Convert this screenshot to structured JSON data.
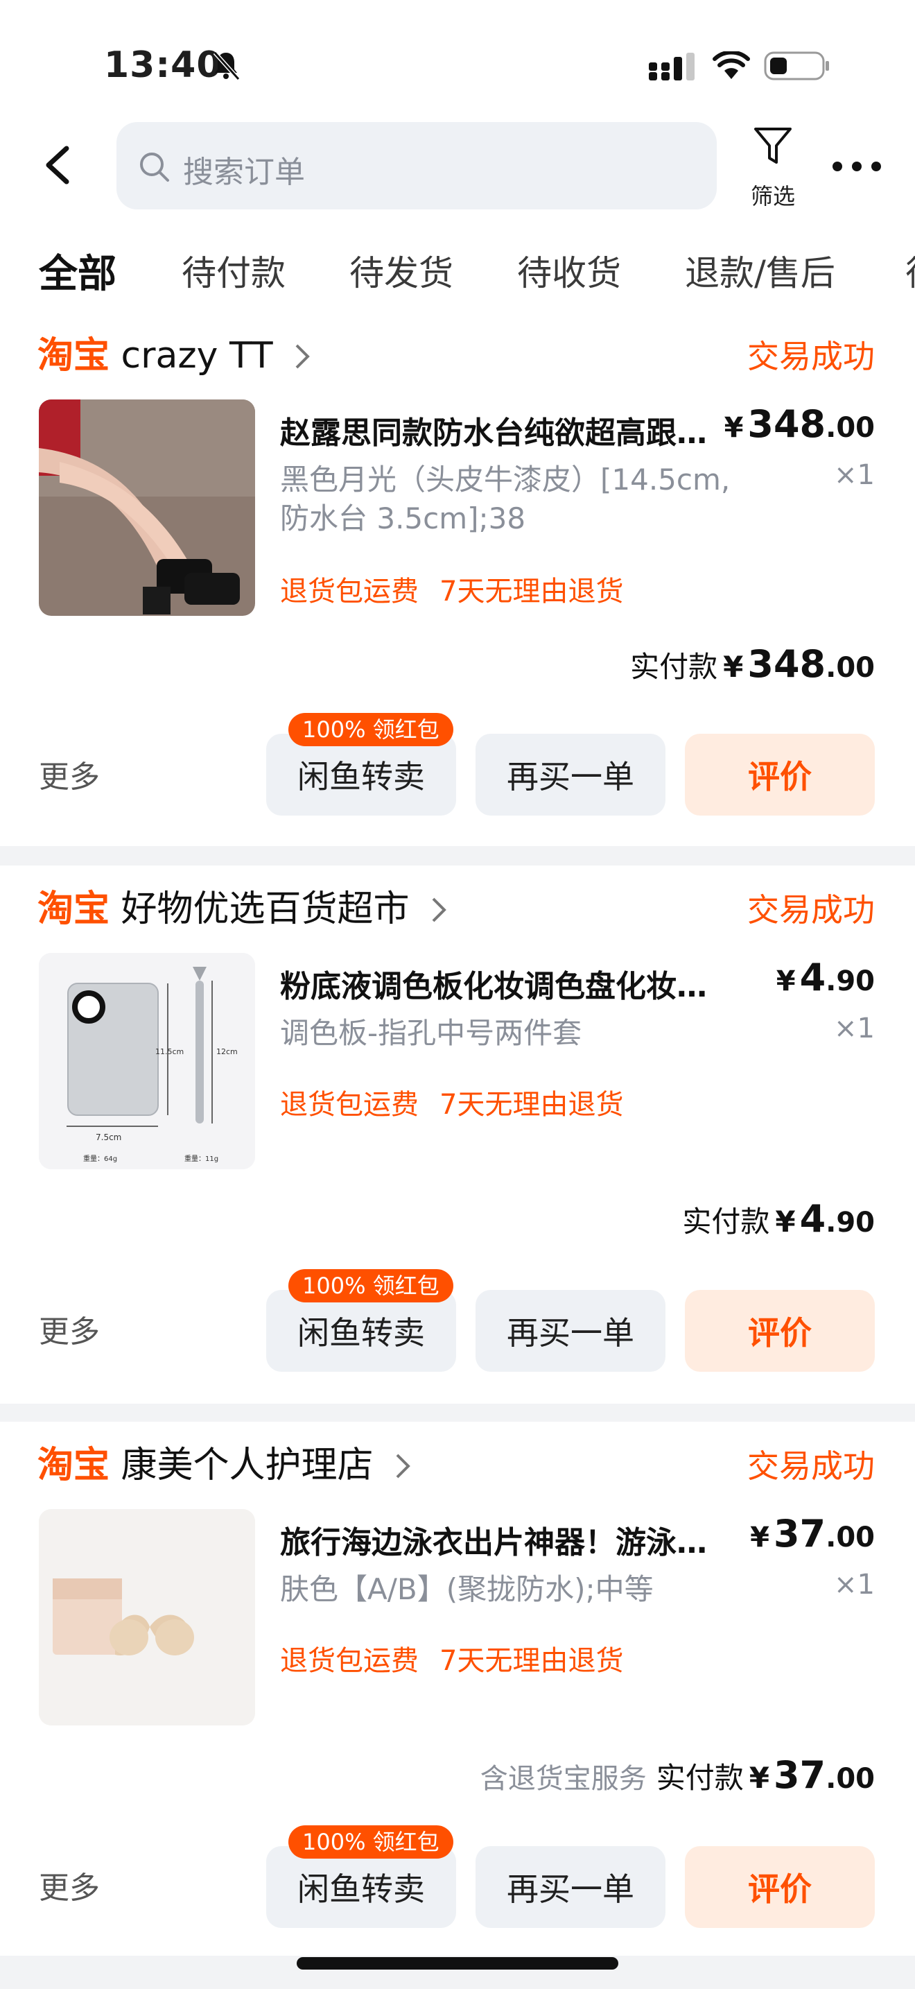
{
  "status_bar": {
    "time": "13:40"
  },
  "header": {
    "search_placeholder": "搜索订单",
    "filter_label": "筛选"
  },
  "tabs": [
    "全部",
    "待付款",
    "待发货",
    "待收货",
    "退款/售后",
    "待"
  ],
  "colors": {
    "accent": "#ff5000",
    "button_bg": "#eef1f5",
    "primary_button_bg": "#ffece0"
  },
  "orders": [
    {
      "platform": "淘宝",
      "shop": "crazy TT",
      "status": "交易成功",
      "title": "赵露思同款防水台纯欲超高跟…",
      "price_currency": "¥",
      "price_int": "348",
      "price_dec": ".00",
      "spec": "黑色月光（头皮牛漆皮）[14.5cm, 防水台 3.5cm];38",
      "qty": "×1",
      "tags": [
        "退货包运费",
        "7天无理由退货"
      ],
      "service_note": "",
      "paid_label": "实付款",
      "paid_currency": "¥",
      "paid_int": "348",
      "paid_dec": ".00",
      "more": "更多",
      "badge": "100% 领红包",
      "btn_resell": "闲鱼转卖",
      "btn_rebuy": "再买一单",
      "btn_review": "评价"
    },
    {
      "platform": "淘宝",
      "shop": "好物优选百货超市",
      "status": "交易成功",
      "title": "粉底液调色板化妆调色盘化妆师…",
      "price_currency": "¥",
      "price_int": "4",
      "price_dec": ".90",
      "spec": "调色板-指孔中号两件套",
      "qty": "×1",
      "tags": [
        "退货包运费",
        "7天无理由退货"
      ],
      "service_note": "",
      "paid_label": "实付款",
      "paid_currency": "¥",
      "paid_int": "4",
      "paid_dec": ".90",
      "more": "更多",
      "badge": "100% 领红包",
      "btn_resell": "闲鱼转卖",
      "btn_rebuy": "再买一单",
      "btn_review": "评价",
      "image_text": {
        "w": "7.5cm",
        "h1": "11.5cm",
        "h2": "12cm",
        "weight1": "重量：64g",
        "weight2": "重量：11g"
      }
    },
    {
      "platform": "淘宝",
      "shop": "康美个人护理店",
      "status": "交易成功",
      "title": "旅行海边泳衣出片神器！游泳胸…",
      "price_currency": "¥",
      "price_int": "37",
      "price_dec": ".00",
      "spec": "肤色【A/B】(聚拢防水);中等",
      "qty": "×1",
      "tags": [
        "退货包运费",
        "7天无理由退货"
      ],
      "service_note": "含退货宝服务",
      "paid_label": "实付款",
      "paid_currency": "¥",
      "paid_int": "37",
      "paid_dec": ".00",
      "more": "更多",
      "badge": "100% 领红包",
      "btn_resell": "闲鱼转卖",
      "btn_rebuy": "再买一单",
      "btn_review": "评价"
    }
  ]
}
